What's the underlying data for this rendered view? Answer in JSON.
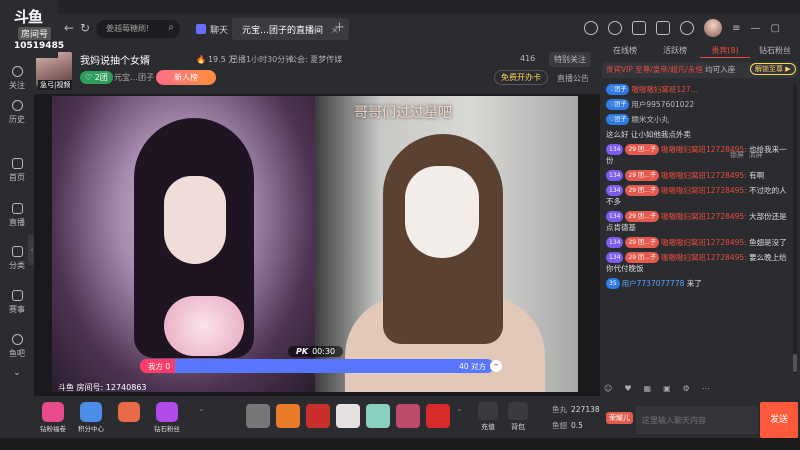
{
  "brand": {
    "logo": "斗鱼",
    "room_label": "房间号",
    "room_id": "10519485"
  },
  "nav": {
    "back": "←",
    "refresh": "↻"
  },
  "search": {
    "placeholder": "姜越莓糖刷!"
  },
  "tabs": [
    {
      "label": "聊天"
    },
    {
      "label": "元宝…团子的直播间"
    }
  ],
  "sidebar": {
    "items": [
      "关注",
      "历史",
      "首页",
      "直播",
      "分类",
      "赛事",
      "鱼吧"
    ]
  },
  "room": {
    "title": "我妈说抽个女婿",
    "hot_label": "🔥",
    "hot_value": "19.5 万",
    "live_time": "已播1小时30分钟",
    "guild": "公会: 夏梦传媒",
    "level": "♡ 2团",
    "host_name": "元宝…团子",
    "new_label": "新人榜",
    "avatar_tag": "急弓|视频",
    "viewers": "416",
    "special_follow": "特别关注",
    "free_card": "免费开办卡",
    "announcement": "直播公告"
  },
  "video": {
    "overlay_text": "哥哥们过过星吧",
    "pk_label": "PK",
    "pk_timer": "00:30",
    "pk_left_label": "我方 0",
    "pk_right_label": "40 对方",
    "pk_left_fraction": 0.0,
    "pk_end": "–",
    "watermark": "斗鱼 房间号: 12740863"
  },
  "toolbar": {
    "gift_buttons": [
      {
        "label": "钻粉福卷",
        "color": "#e84a8c"
      },
      {
        "label": "积分中心",
        "color": "#4a8ce8"
      },
      {
        "label": "",
        "color": "#e86a4a"
      },
      {
        "label": "钻石粉丝",
        "color": "#b04ae8"
      }
    ],
    "gift_colors": [
      "#888",
      "#e87a2a",
      "#c9302c",
      "#e6e0e0",
      "#8ad0c0",
      "#c04a6a",
      "#d82a2a"
    ],
    "recharge": "充值",
    "backpack": "背包",
    "fish_pills_label": "鱼丸",
    "fish_pills": "227138",
    "fish_wings_label": "鱼翅",
    "fish_wings": "0.5"
  },
  "right": {
    "tabs": [
      "在线榜",
      "活跃榜",
      "贵宾(8)",
      "钻石粉丝"
    ],
    "active_tab": 2,
    "notice_prefix": "贵宾VIP 至尊/皇帝/超凡/永恒",
    "notice_suffix": " 均可入座",
    "unlock_label": "解锁至尊 ▶",
    "chat_tools": [
      "锁屏",
      "清屏"
    ],
    "messages": [
      {
        "fan": "♡团子",
        "user": "嗷嗷嗷妇窝班127…",
        "text": "",
        "user_style": "red"
      },
      {
        "fan": "♡团子",
        "user": "用户9957601022",
        "text": "",
        "user_style": "plain"
      },
      {
        "fan": "♡团子",
        "user": "糯米文小丸",
        "text": "",
        "user_style": "plain"
      },
      {
        "fan": "",
        "user": "",
        "text": "这么好 让小如他我点外卖",
        "user_style": "plain"
      },
      {
        "fan": "134",
        "lv": "29 团…子",
        "user": "嗷嗷嗷妇窝班12728495:",
        "text": " 也给我来一份",
        "user_style": "red"
      },
      {
        "fan": "134",
        "lv": "29 团…子",
        "user": "嗷嗷嗷妇窝班12728495:",
        "text": " 有啊",
        "user_style": "red"
      },
      {
        "fan": "134",
        "lv": "29 团…子",
        "user": "嗷嗷嗷妇窝班12728495:",
        "text": " 不过吃的人不多",
        "user_style": "red"
      },
      {
        "fan": "134",
        "lv": "29 团…子",
        "user": "嗷嗷嗷妇窝班12728495:",
        "text": " 大部份还是点肯德基",
        "user_style": "red"
      },
      {
        "fan": "134",
        "lv": "29 团…子",
        "user": "嗷嗷嗷妇窝班12728495:",
        "text": " 鱼翅是没了",
        "user_style": "red"
      },
      {
        "fan": "134",
        "lv": "29 团…子",
        "user": "嗷嗷嗷妇窝班12728495:",
        "text": " 要么晚上给你代付晚饭",
        "user_style": "red"
      },
      {
        "fan": "35",
        "user": "用户7737077778",
        "text": " 来了",
        "user_style": "blue"
      }
    ],
    "chat_toolbar": [
      "☺",
      "♥",
      "▦",
      "▣",
      "⚙",
      "⋯"
    ],
    "fans_label": "荣耀儿",
    "input_placeholder": "这里输入聊天内容",
    "send_label": "发送"
  }
}
